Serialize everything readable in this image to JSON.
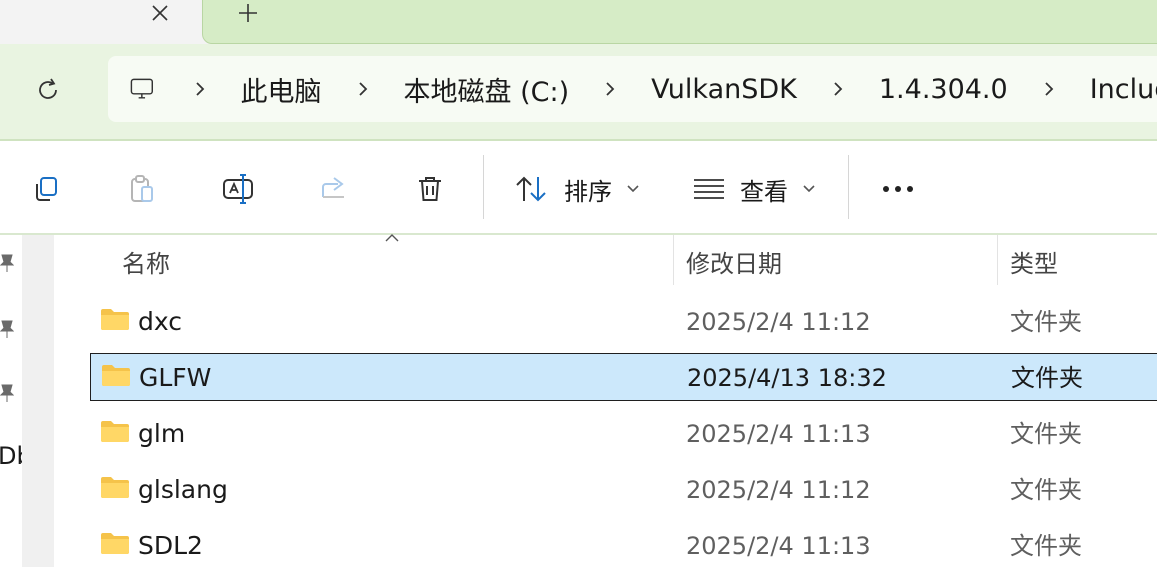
{
  "tabs": {
    "close_icon": "close-icon",
    "new_tab_icon": "plus-icon"
  },
  "address_bar": {
    "refresh_icon": "refresh-icon",
    "root_icon": "monitor-icon",
    "crumbs": [
      "此电脑",
      "本地磁盘 (C:)",
      "VulkanSDK",
      "1.4.304.0",
      "Include"
    ]
  },
  "toolbar": {
    "sort_label": "排序",
    "view_label": "查看"
  },
  "columns": {
    "name": "名称",
    "date": "修改日期",
    "type": "类型"
  },
  "nav_pane": {
    "cut_label": "Db"
  },
  "files": [
    {
      "name": "dxc",
      "date": "2025/2/4 11:12",
      "type": "文件夹",
      "selected": false
    },
    {
      "name": "GLFW",
      "date": "2025/4/13 18:32",
      "type": "文件夹",
      "selected": true
    },
    {
      "name": "glm",
      "date": "2025/2/4 11:13",
      "type": "文件夹",
      "selected": false
    },
    {
      "name": "glslang",
      "date": "2025/2/4 11:12",
      "type": "文件夹",
      "selected": false
    },
    {
      "name": "SDL2",
      "date": "2025/2/4 11:13",
      "type": "文件夹",
      "selected": false
    }
  ],
  "colors": {
    "accent": "#1a6fc4",
    "selection": "#cce8fb",
    "tab_active": "#d6ecc6",
    "folder": "#f5c34a"
  }
}
